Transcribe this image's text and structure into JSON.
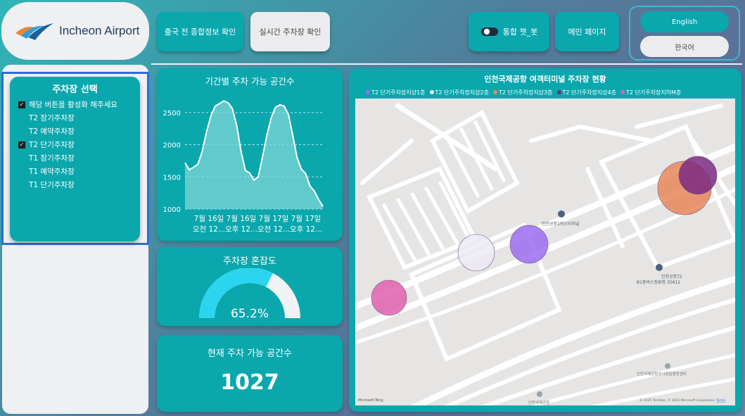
{
  "header": {
    "logo_text": "Incheon Airport",
    "buttons": {
      "pre_departure": "출국 전 종합정보 확인",
      "realtime_parking": "실시간 주차장 확인",
      "chatbot": "통합 챗_봇",
      "main_page": "메인 페이지"
    },
    "languages": {
      "english": "English",
      "korean": "한국어"
    }
  },
  "slicer": {
    "title": "주차장 선택",
    "items": [
      {
        "label": "해당 버튼을 활성화 해주세요",
        "checked": true
      },
      {
        "label": "T2 장기주차장",
        "checked": false
      },
      {
        "label": "T2 예약주차장",
        "checked": false
      },
      {
        "label": "T2 단기주차장",
        "checked": true
      },
      {
        "label": "T1 장기주차장",
        "checked": false
      },
      {
        "label": "T1 예약주차장",
        "checked": false
      },
      {
        "label": "T1 단기주차장",
        "checked": false
      }
    ]
  },
  "availability_chart": {
    "title": "기간별 주차 가능 공간수",
    "chart_data": {
      "type": "area",
      "yticks": [
        1000,
        1500,
        2000,
        2500
      ],
      "ylim": [
        1000,
        2750
      ],
      "xticks": [
        [
          "7월 16일",
          "오전 12..."
        ],
        [
          "7월 16일",
          "오후 12..."
        ],
        [
          "7월 17일",
          "오전 12..."
        ],
        [
          "7월 17일",
          "오후 12..."
        ]
      ],
      "values": [
        1720,
        1610,
        1650,
        1700,
        1900,
        2200,
        2450,
        2600,
        2640,
        2680,
        2650,
        2560,
        2300,
        1900,
        1600,
        1560,
        1450,
        1500,
        1820,
        2150,
        2420,
        2580,
        2620,
        2600,
        2470,
        2150,
        1800,
        1620,
        1550,
        1360,
        1280,
        1150,
        1040
      ]
    }
  },
  "congestion": {
    "title": "주차장 혼잡도",
    "value_label": "65.2%",
    "fraction": 0.652,
    "fill_color": "#2bd5f0",
    "track_color": "#f0f2f3"
  },
  "current_available": {
    "title": "현재 주차 가능 공간수",
    "value": "1027"
  },
  "map": {
    "title": "인천국제공항 여객터미널 주차장 현황",
    "legend": [
      {
        "label": "T2 단기주차장지상1층",
        "color": "#9b6cf0"
      },
      {
        "label": "T2 단기주차장지상2층",
        "color": "#eceaf5"
      },
      {
        "label": "T2 단기주차장지상3층",
        "color": "#e8875a"
      },
      {
        "label": "T2 단기주차장지상4층",
        "color": "#7b2a80"
      },
      {
        "label": "T2 단기주차장지하M층",
        "color": "#e060b0"
      }
    ],
    "labels": {
      "bus_terminal": "인천공항1버스터미널",
      "bus_stop_line1": "인천공항T2",
      "bus_stop_line2": "B1층버스정류장 35612",
      "bottom_building": "인천국제공항공사종합행정센터",
      "bottom_road": "인천국제공항",
      "attribution": "© 2025 TomTom, © 2025 Microsoft Corporation",
      "terms": "Terms",
      "brand": "Microsoft Bing"
    }
  }
}
